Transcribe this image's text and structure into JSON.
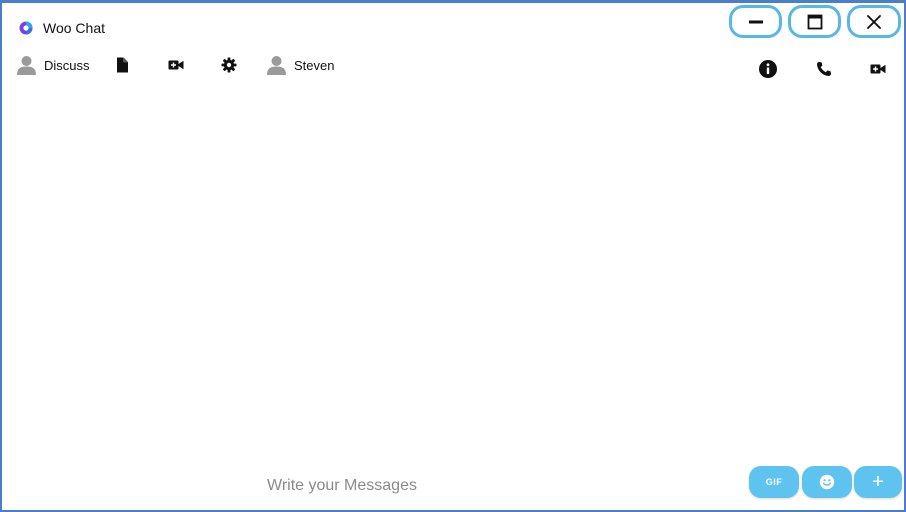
{
  "window": {
    "title": "Woo Chat",
    "accent_color": "#5ab6e4",
    "border_color": "#4a7fc8"
  },
  "controls": {
    "minimize_icon": "minimize-icon",
    "maximize_icon": "maximize-icon",
    "close_icon": "close-icon"
  },
  "tabs": [
    {
      "label": "Discussion",
      "icon": "user-avatar-icon"
    },
    {
      "label": "Steven",
      "icon": "user-avatar-icon"
    }
  ],
  "tools": [
    "document-icon",
    "video-camera-icon",
    "settings-gear-icon"
  ],
  "actions": [
    "info-icon",
    "phone-icon",
    "video-call-icon"
  ],
  "composer": {
    "placeholder": "Write your Messages",
    "button_color": "#5fc3f0",
    "gif_label": "GIF",
    "emoji_icon": "smiley-icon",
    "plus_label": "+"
  }
}
